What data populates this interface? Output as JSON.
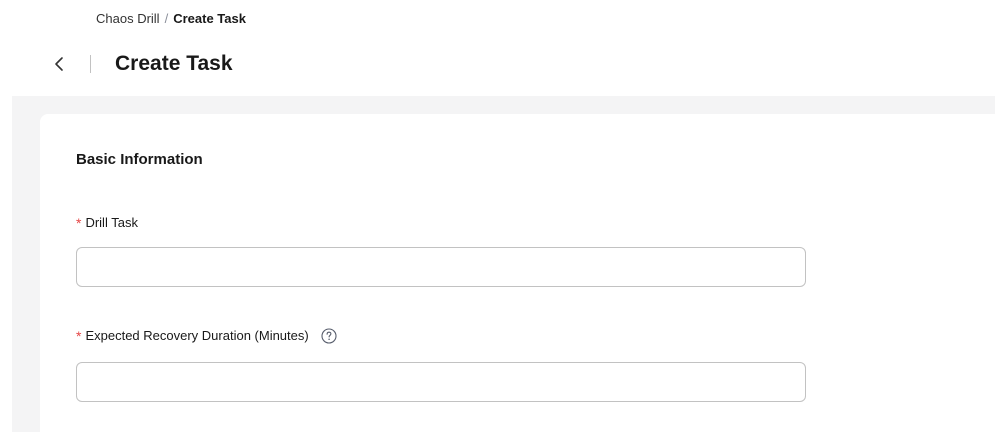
{
  "breadcrumb": {
    "parent": "Chaos Drill",
    "separator": "/",
    "current": "Create Task"
  },
  "header": {
    "title": "Create Task",
    "back_icon": "chevron-left-icon"
  },
  "form": {
    "section_title": "Basic Information",
    "required_marker": "*",
    "fields": [
      {
        "label": "Drill Task",
        "value": "",
        "placeholder": ""
      },
      {
        "label": "Expected Recovery Duration (Minutes)",
        "value": "",
        "placeholder": "",
        "help_icon": "question-circle-icon"
      }
    ]
  },
  "colors": {
    "required": "#e54545",
    "page_bg": "#f4f4f5",
    "card_bg": "#ffffff",
    "input_border": "#c2c2c2"
  }
}
